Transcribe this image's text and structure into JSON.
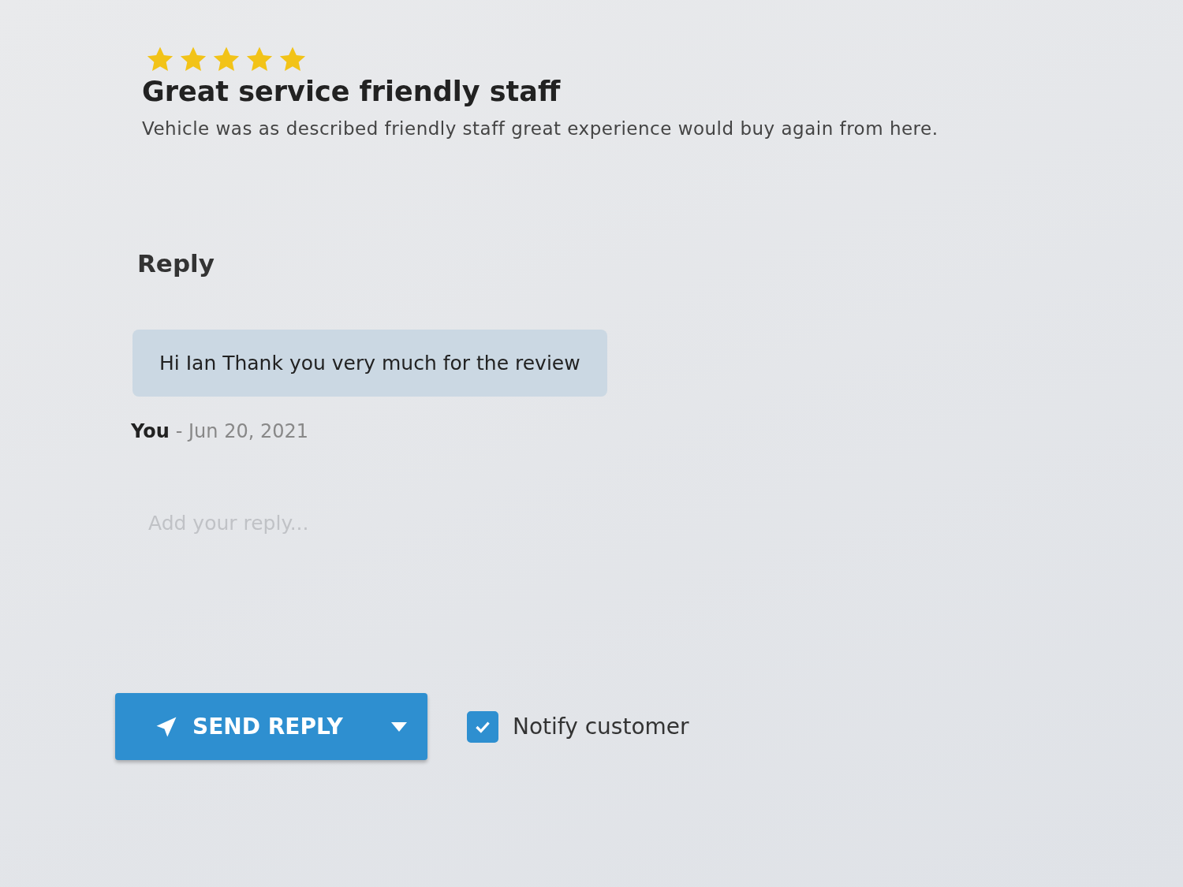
{
  "review": {
    "stars": 5,
    "title": "Great service friendly staff",
    "body": "Vehicle was as described friendly staff great experience would buy again from here."
  },
  "reply_section": {
    "heading": "Reply",
    "message": "Hi Ian Thank you very much for the review",
    "author": "You",
    "date": "- Jun 20, 2021"
  },
  "reply_field": {
    "placeholder": "Add your reply..."
  },
  "send_button": {
    "label": "SEND REPLY"
  },
  "notify": {
    "label": "Notify customer",
    "checked": true
  }
}
